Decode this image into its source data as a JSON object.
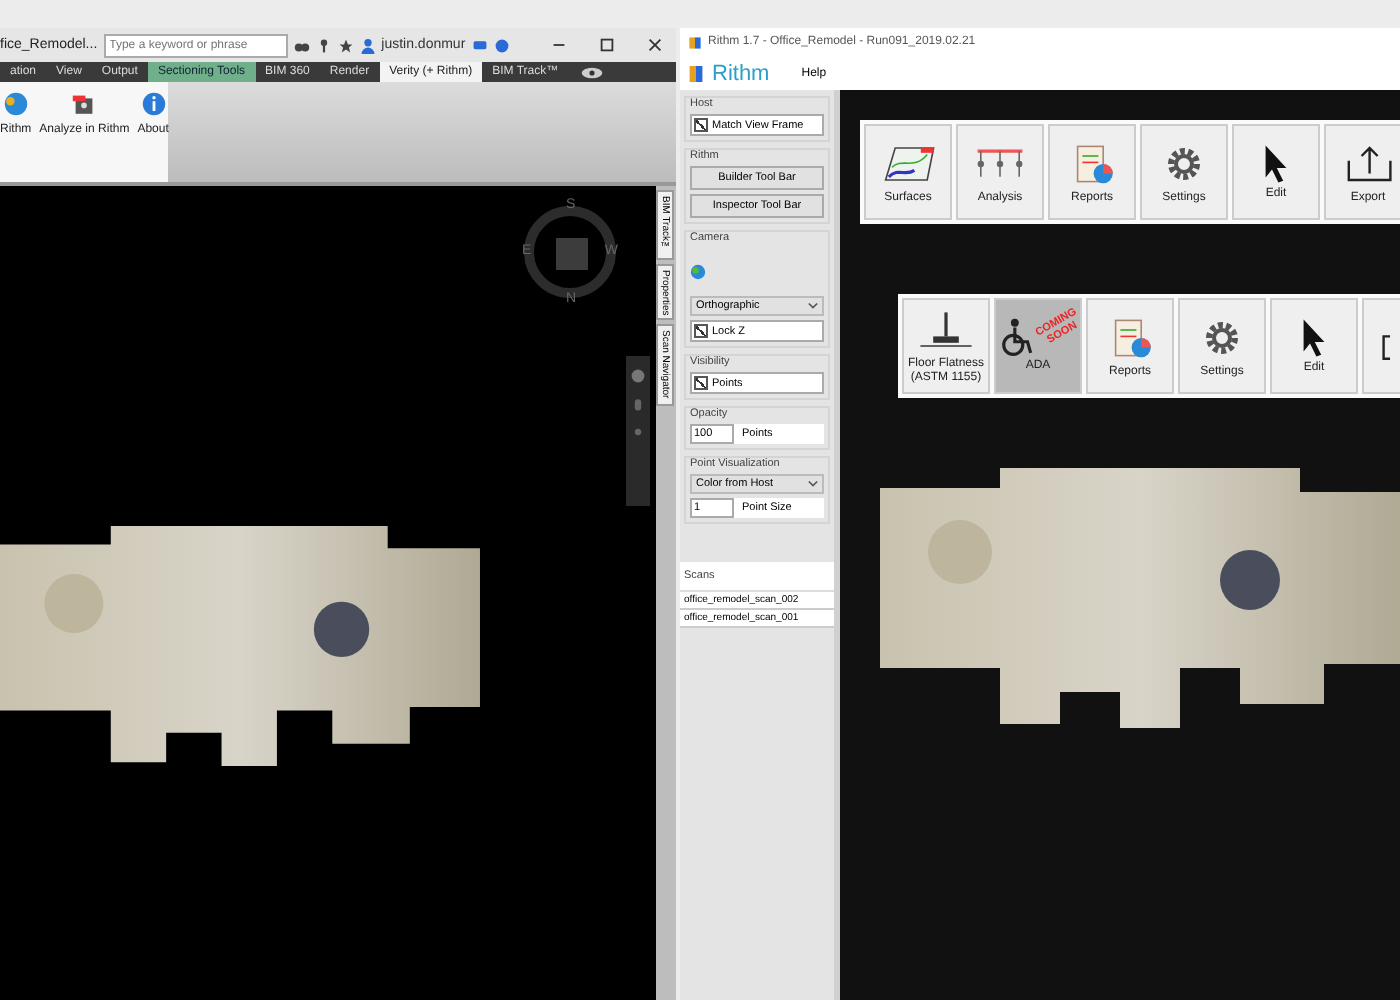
{
  "left_app": {
    "title": "fice_Remodel...",
    "search": {
      "placeholder": "Type a keyword or phrase"
    },
    "user": "justin.donmur",
    "ribbon_tabs": [
      {
        "label": "ation",
        "kind": "normal",
        "selected": false
      },
      {
        "label": "View",
        "kind": "normal",
        "selected": false
      },
      {
        "label": "Output",
        "kind": "normal",
        "selected": false
      },
      {
        "label": "Sectioning Tools",
        "kind": "contextual",
        "selected": false
      },
      {
        "label": "BIM 360",
        "kind": "normal",
        "selected": false
      },
      {
        "label": "Render",
        "kind": "normal",
        "selected": false
      },
      {
        "label": "Verity (+ Rithm)",
        "kind": "normal",
        "selected": true
      },
      {
        "label": "BIM Track™",
        "kind": "normal",
        "selected": false
      }
    ],
    "ribbon_buttons": [
      {
        "label": "Rithm",
        "kind": "rithm"
      },
      {
        "label": "Analyze in Rithm",
        "kind": "analyze"
      },
      {
        "label": "About",
        "kind": "about"
      }
    ],
    "compass": {
      "top": "S",
      "left": "E",
      "right": "W",
      "bottom": "N"
    },
    "side_tabs": [
      "BIM Track™",
      "Properties",
      "Scan Navigator"
    ]
  },
  "right_app": {
    "title": "Rithm 1.7 - Office_Remodel - Run091_2019.02.21",
    "logo": "Rithm",
    "menu": [
      "Help"
    ],
    "panel": {
      "host": {
        "label": "Host",
        "match_view_frame": {
          "label": "Match View Frame",
          "checked": true
        }
      },
      "rithm": {
        "label": "Rithm",
        "buttons": [
          "Builder Tool Bar",
          "Inspector Tool Bar"
        ]
      },
      "camera": {
        "label": "Camera",
        "projection": "Orthographic",
        "lock_z": {
          "label": "Lock Z",
          "checked": true
        }
      },
      "visibility": {
        "label": "Visibility",
        "points": {
          "label": "Points",
          "checked": true
        }
      },
      "opacity": {
        "label": "Opacity",
        "value": "100",
        "unit": "Points"
      },
      "point_visualization": {
        "label": "Point Visualization",
        "mode": "Color from Host",
        "size": "1",
        "size_label": "Point Size"
      },
      "scans": {
        "label": "Scans",
        "items": [
          "office_remodel_scan_002",
          "office_remodel_scan_001"
        ]
      }
    },
    "toolbars": [
      [
        {
          "label": "Surfaces",
          "kind": "surfaces",
          "pressed": false
        },
        {
          "label": "Analysis",
          "kind": "analysis",
          "pressed": false
        },
        {
          "label": "Reports",
          "kind": "reports",
          "pressed": false
        },
        {
          "label": "Settings",
          "kind": "settings",
          "pressed": false
        },
        {
          "label": "Edit",
          "kind": "edit",
          "pressed": false
        },
        {
          "label": "Export",
          "kind": "export",
          "pressed": false
        }
      ],
      [
        {
          "label": "Floor Flatness (ASTM 1155)",
          "kind": "flatness",
          "pressed": false
        },
        {
          "label": "ADA",
          "kind": "ada",
          "pressed": true,
          "stamp": "COMING SOON"
        },
        {
          "label": "Reports",
          "kind": "reports",
          "pressed": false
        },
        {
          "label": "Settings",
          "kind": "settings",
          "pressed": false
        },
        {
          "label": "Edit",
          "kind": "edit",
          "pressed": false
        },
        {
          "kind": "partial",
          "pressed": false
        }
      ]
    ]
  }
}
